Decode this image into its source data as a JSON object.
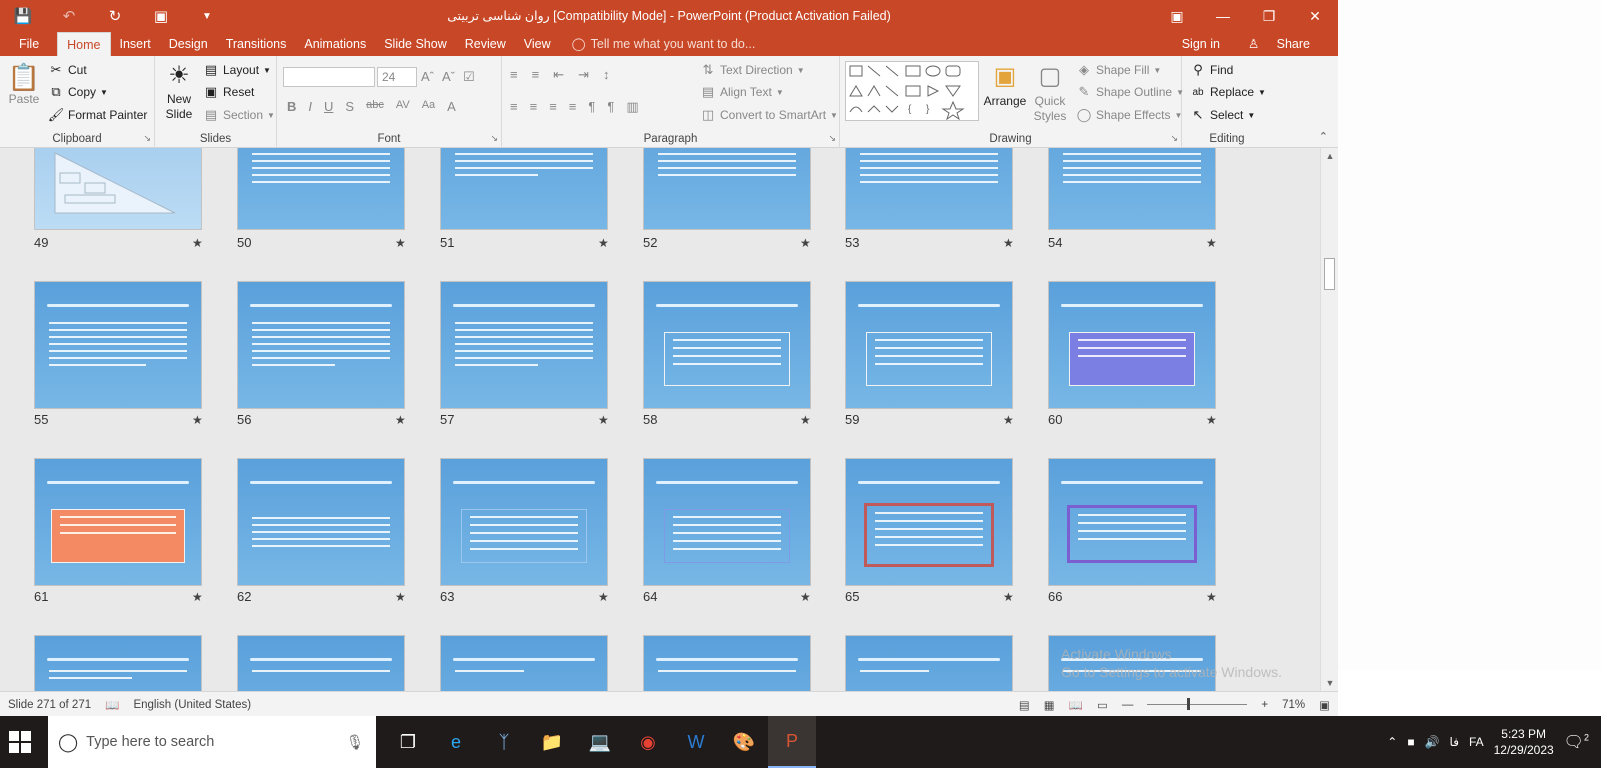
{
  "titlebar": {
    "title": "روان شناسی تربیتی [Compatibility Mode] - PowerPoint (Product Activation Failed)"
  },
  "menu": {
    "tabs": [
      "File",
      "Home",
      "Insert",
      "Design",
      "Transitions",
      "Animations",
      "Slide Show",
      "Review",
      "View"
    ],
    "active": "Home",
    "tell_me": "Tell me what you want to do...",
    "sign_in": "Sign in",
    "share": "Share"
  },
  "ribbon": {
    "clipboard": {
      "name": "Clipboard",
      "paste": "Paste",
      "cut": "Cut",
      "copy": "Copy",
      "format_painter": "Format Painter"
    },
    "slides": {
      "name": "Slides",
      "new_slide_1": "New",
      "new_slide_2": "Slide",
      "layout": "Layout",
      "reset": "Reset",
      "section": "Section"
    },
    "font": {
      "name": "Font",
      "size": "24"
    },
    "paragraph": {
      "name": "Paragraph",
      "text_direction": "Text Direction",
      "align_text": "Align Text",
      "convert_smartart": "Convert to SmartArt"
    },
    "drawing": {
      "name": "Drawing",
      "arrange": "Arrange",
      "quick_styles_1": "Quick",
      "quick_styles_2": "Styles",
      "shape_fill": "Shape Fill",
      "shape_outline": "Shape Outline",
      "shape_effects": "Shape Effects"
    },
    "editing": {
      "name": "Editing",
      "find": "Find",
      "replace": "Replace",
      "select": "Select"
    }
  },
  "slides": {
    "rows": [
      [
        "49",
        "50",
        "51",
        "52",
        "53",
        "54"
      ],
      [
        "55",
        "56",
        "57",
        "58",
        "59",
        "60"
      ],
      [
        "61",
        "62",
        "63",
        "64",
        "65",
        "66"
      ]
    ],
    "watermark_1": "Activate Windows",
    "watermark_2": "Go to Settings to activate Windows."
  },
  "status": {
    "slide": "Slide 271 of 271",
    "language": "English (United States)",
    "zoom": "71%"
  },
  "taskbar": {
    "search_placeholder": "Type here to search",
    "lang": "FA",
    "lang2": "فا",
    "time": "5:23 PM",
    "date": "12/29/2023",
    "notifications": "2"
  },
  "colors": {
    "accent": "#c84727",
    "slide_blue": "#5aa0db"
  }
}
